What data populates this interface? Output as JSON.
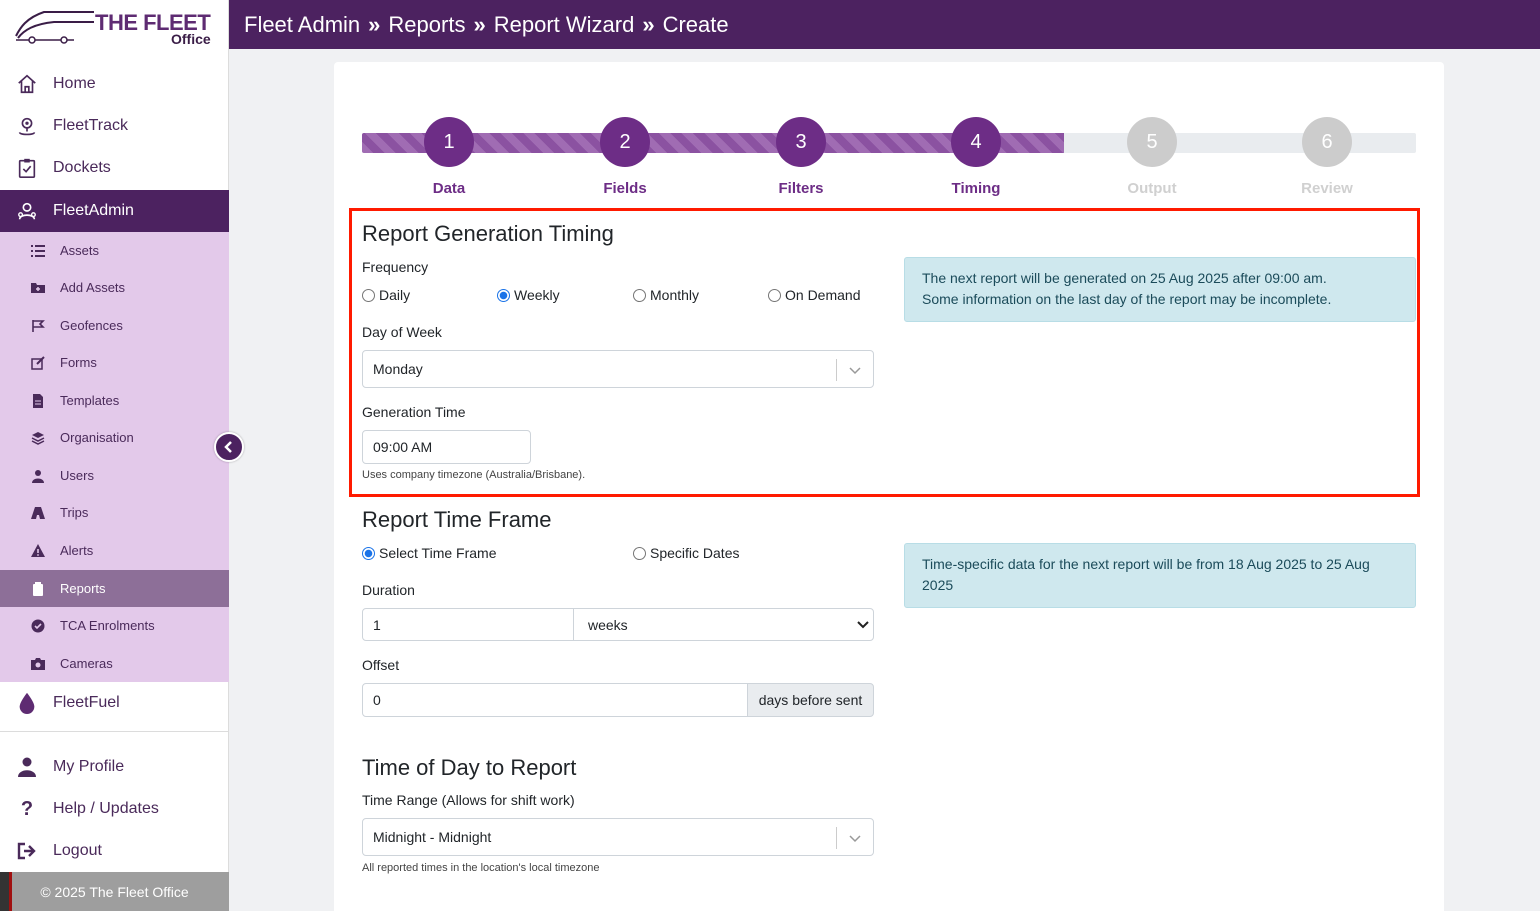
{
  "brand": {
    "title": "THE FLEET",
    "subtitle": "Office"
  },
  "header": {
    "crumbs": [
      "Fleet Admin",
      "Reports",
      "Report Wizard",
      "Create"
    ]
  },
  "nav": [
    {
      "label": "Home",
      "icon": "home-icon"
    },
    {
      "label": "FleetTrack",
      "icon": "location-pin-icon"
    },
    {
      "label": "Dockets",
      "icon": "clipboard-check-icon"
    },
    {
      "label": "FleetAdmin",
      "icon": "user-group-icon"
    }
  ],
  "subnav": [
    {
      "label": "Assets",
      "icon": "list-icon"
    },
    {
      "label": "Add Assets",
      "icon": "folder-plus-icon"
    },
    {
      "label": "Geofences",
      "icon": "map-flag-icon"
    },
    {
      "label": "Forms",
      "icon": "edit-icon"
    },
    {
      "label": "Templates",
      "icon": "file-icon"
    },
    {
      "label": "Organisation",
      "icon": "layers-icon"
    },
    {
      "label": "Users",
      "icon": "user-icon"
    },
    {
      "label": "Trips",
      "icon": "road-icon"
    },
    {
      "label": "Alerts",
      "icon": "warning-icon"
    },
    {
      "label": "Reports",
      "icon": "clipboard-icon"
    },
    {
      "label": "TCA Enrolments",
      "icon": "check-circle-icon"
    },
    {
      "label": "Cameras",
      "icon": "camera-icon"
    }
  ],
  "fleetfuel": {
    "label": "FleetFuel",
    "icon": "droplet-icon"
  },
  "bottom_nav": [
    {
      "label": "My Profile",
      "icon": "user-icon"
    },
    {
      "label": "Help / Updates",
      "icon": "question-icon"
    },
    {
      "label": "Logout",
      "icon": "logout-icon"
    }
  ],
  "footer": "© 2025 The Fleet Office",
  "steps": [
    {
      "num": "1",
      "label": "Data"
    },
    {
      "num": "2",
      "label": "Fields"
    },
    {
      "num": "3",
      "label": "Filters"
    },
    {
      "num": "4",
      "label": "Timing"
    },
    {
      "num": "5",
      "label": "Output"
    },
    {
      "num": "6",
      "label": "Review"
    }
  ],
  "timing": {
    "title": "Report Generation Timing",
    "frequency_label": "Frequency",
    "frequency_options": [
      "Daily",
      "Weekly",
      "Monthly",
      "On Demand"
    ],
    "frequency_selected": "Weekly",
    "day_label": "Day of Week",
    "day_value": "Monday",
    "time_label": "Generation Time",
    "time_value": "09:00 AM",
    "tz_note": "Uses company timezone (Australia/Brisbane).",
    "info_line1": "The next report will be generated on 25 Aug 2025 after 09:00 am.",
    "info_line2": "Some information on the last day of the report may be incomplete."
  },
  "timeframe": {
    "title": "Report Time Frame",
    "opt_select": "Select Time Frame",
    "opt_specific": "Specific Dates",
    "selected": "Select Time Frame",
    "duration_label": "Duration",
    "duration_value": "1",
    "duration_unit": "weeks",
    "offset_label": "Offset",
    "offset_value": "0",
    "offset_suffix": "days before sent",
    "info": "Time-specific data for the next report will be from 18 Aug 2025 to 25 Aug 2025"
  },
  "timeofday": {
    "title": "Time of Day to Report",
    "range_label": "Time Range (Allows for shift work)",
    "range_value": "Midnight - Midnight",
    "note": "All reported times in the location's local timezone"
  }
}
